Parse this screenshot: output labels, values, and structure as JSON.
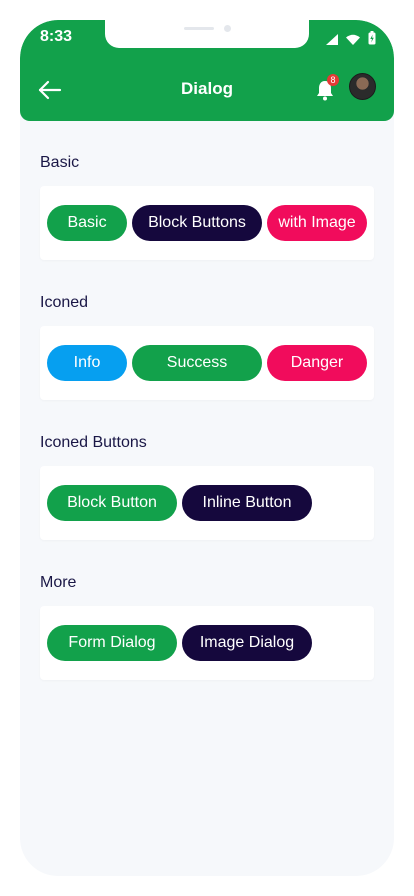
{
  "status_bar": {
    "time": "8:33"
  },
  "header": {
    "title": "Dialog",
    "notification_count": "8"
  },
  "colors": {
    "green": "#12a14b",
    "navy": "#15083d",
    "pink": "#f10c5c",
    "blue": "#069ff0"
  },
  "icons": [
    "back-arrow-icon",
    "bell-icon",
    "signal-icon",
    "wifi-icon",
    "battery-icon"
  ],
  "sections": [
    {
      "title": "Basic",
      "buttons": [
        "Basic",
        "Block Buttons",
        "with Image"
      ]
    },
    {
      "title": "Iconed",
      "buttons": [
        "Info",
        "Success",
        "Danger"
      ]
    },
    {
      "title": "Iconed Buttons",
      "buttons": [
        "Block Button",
        "Inline Button"
      ]
    },
    {
      "title": "More",
      "buttons": [
        "Form Dialog",
        "Image Dialog"
      ]
    }
  ]
}
